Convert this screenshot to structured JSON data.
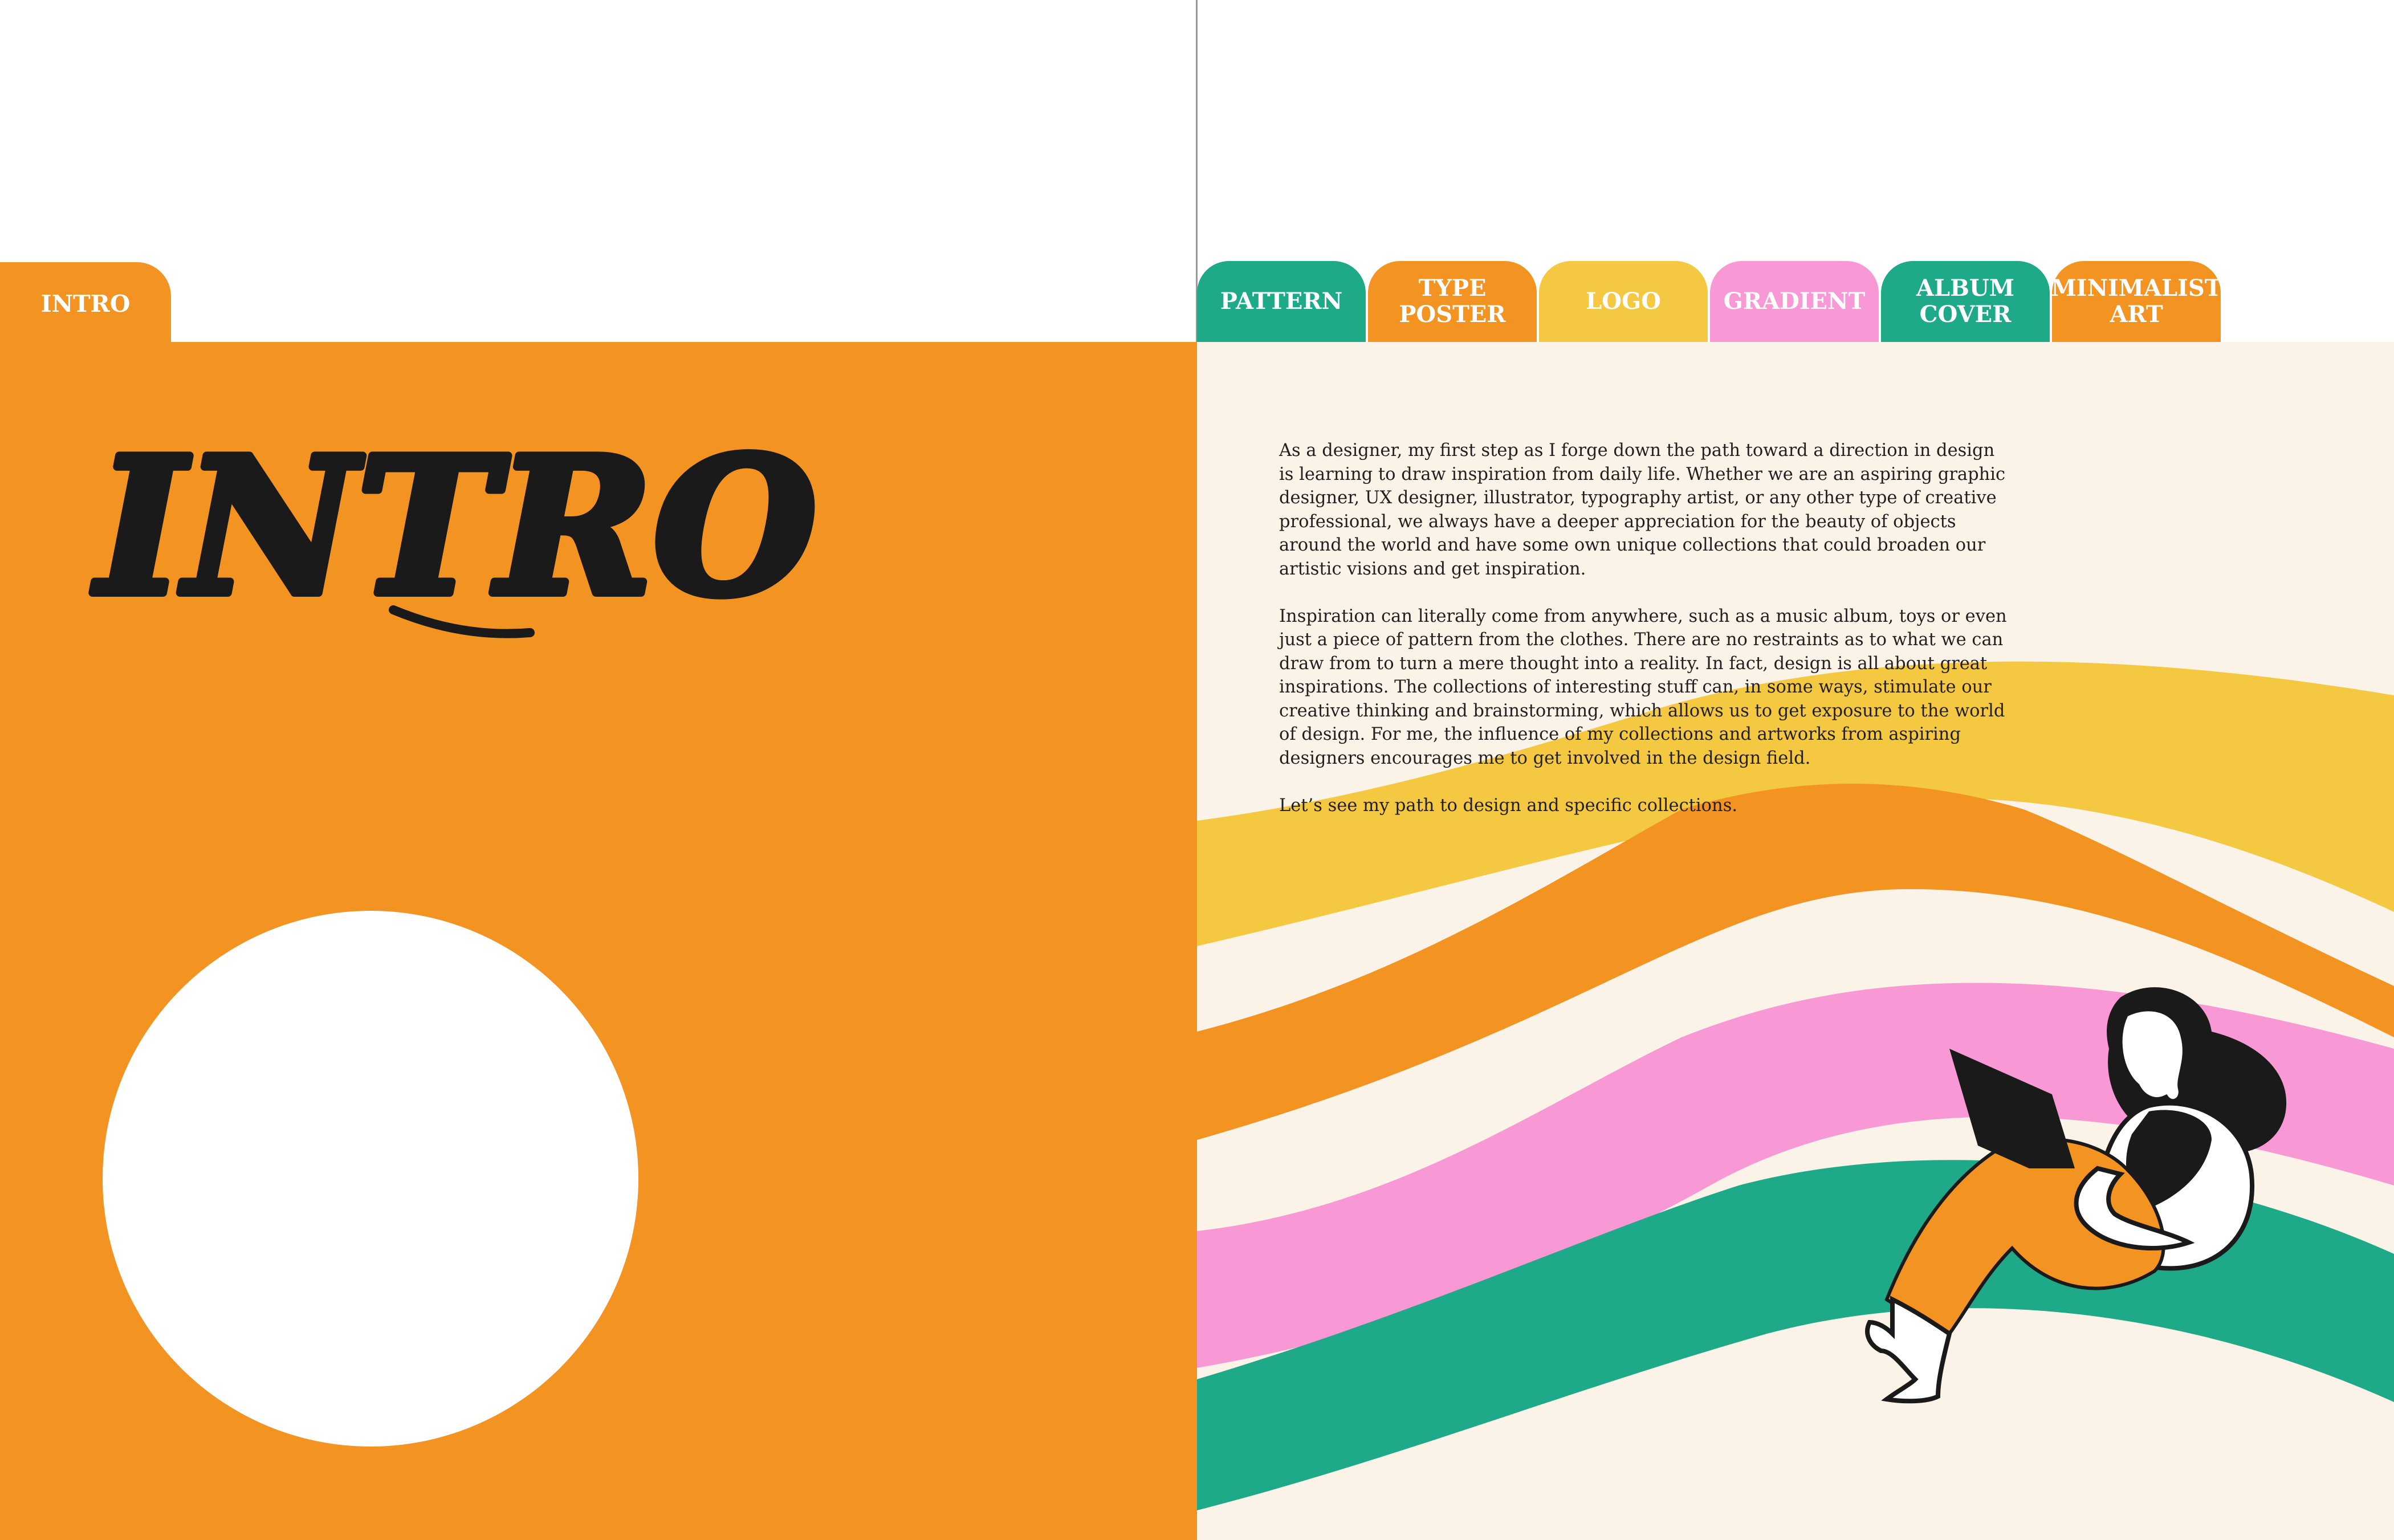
{
  "left_page": {
    "tab_label": "INTRO",
    "title": "INTRO",
    "panel_color": "#f39321"
  },
  "right_page": {
    "tabs": [
      {
        "label": "PATTERN",
        "color": "#1eaa88"
      },
      {
        "label": "TYPE\nPOSTER",
        "color": "#f39321"
      },
      {
        "label": "LOGO",
        "color": "#f5c842"
      },
      {
        "label": "GRADIENT",
        "color": "#f899d6"
      },
      {
        "label": "ALBUM\nCOVER",
        "color": "#1eaa88"
      },
      {
        "label": "MINIMALIST\nART",
        "color": "#f39321"
      }
    ],
    "paragraphs": [
      "As a designer, my first step as I forge down the path toward a direction in design is learning to draw inspiration from daily life. Whether we are an aspiring graphic designer, UX designer, illustrator, typography artist, or any other type of creative professional, we always have a deeper appreciation for the beauty of objects around the world and have some own unique collections that could broaden our artistic visions and get inspiration.",
      "Inspiration can literally come from anywhere, such as a music album, toys or even just a piece of pattern from the clothes. There are no restraints as to what we can draw from to turn a mere thought into a reality. In fact, design is all about great inspirations. The collections of interesting stuff can, in some ways, stimulate our creative thinking and brainstorming, which allows us to get exposure to the world of design. For me, the influence of my collections and artworks from aspiring designers encourages me to get involved in the design field.",
      "Let’s see my path to design and specific collections."
    ],
    "background_color": "#fbf3e7",
    "wave_colors": {
      "yellow": "#f5c842",
      "orange": "#f39321",
      "pink": "#f899d6",
      "green": "#1eaa88"
    },
    "illustration": "woman-reading-illustration"
  }
}
